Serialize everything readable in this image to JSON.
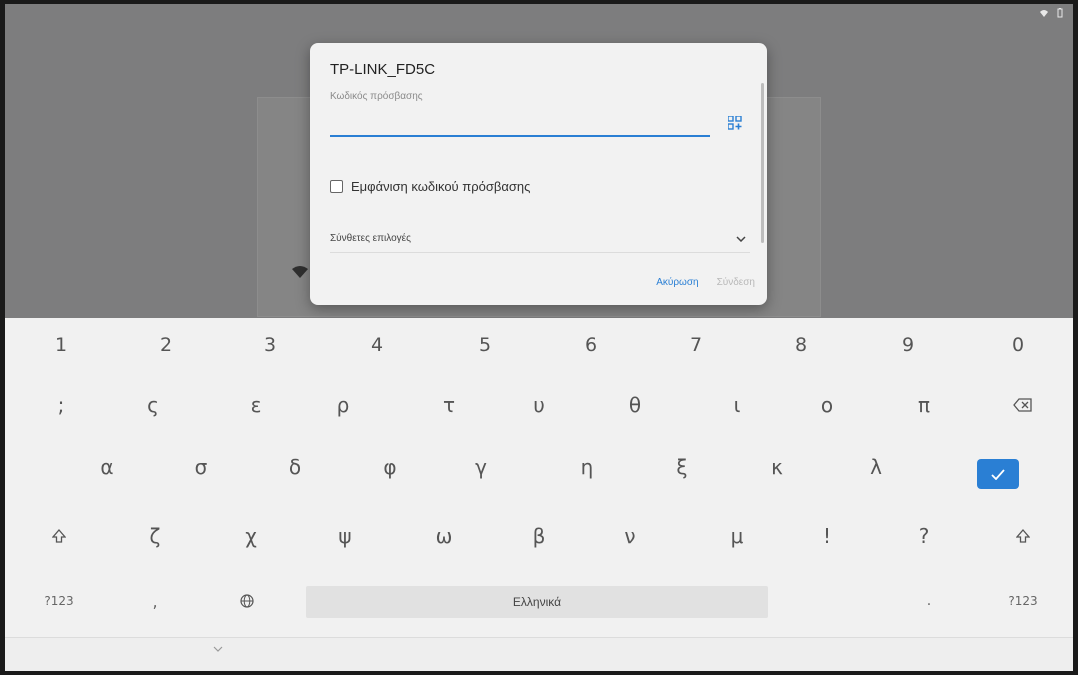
{
  "status_bar": {
    "icons": [
      "wifi-icon",
      "battery-icon"
    ]
  },
  "dialog": {
    "title": "TP-LINK_FD5C",
    "password_label": "Κωδικός πρόσβασης",
    "password_value": "",
    "show_password_label": "Εμφάνιση κωδικού πρόσβασης",
    "advanced_label": "Σύνθετες επιλογές",
    "cancel_label": "Ακύρωση",
    "connect_label": "Σύνδεση"
  },
  "keyboard": {
    "row_numbers": [
      "1",
      "2",
      "3",
      "4",
      "5",
      "6",
      "7",
      "8",
      "9",
      "0"
    ],
    "row_1": [
      ";",
      "ς",
      "ε",
      "ρ",
      "τ",
      "υ",
      "θ",
      "ι",
      "ο",
      "π"
    ],
    "row_2": [
      "α",
      "σ",
      "δ",
      "φ",
      "γ",
      "η",
      "ξ",
      "κ",
      "λ"
    ],
    "row_3": [
      "ζ",
      "χ",
      "ψ",
      "ω",
      "β",
      "ν",
      "μ",
      "!",
      "?"
    ],
    "symbols_left": "?123",
    "comma": ",",
    "space_label": "Ελληνικά",
    "period": ".",
    "symbols_right": "?123"
  },
  "colors": {
    "accent": "#2a7fd4",
    "keyboard_bg": "#f1f1f1",
    "dim_bg": "#7d7d7e"
  }
}
